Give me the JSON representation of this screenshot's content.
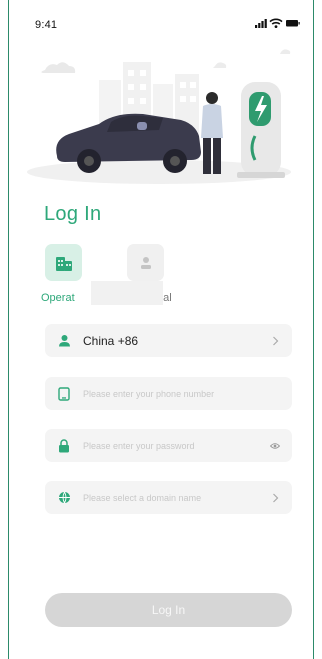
{
  "status_bar": {
    "time": "9:41"
  },
  "title": "Log In",
  "login_types": [
    {
      "label": "Operat",
      "icon": "building-icon",
      "selected": true
    },
    {
      "label": "nal",
      "icon": "person-icon",
      "selected": false
    }
  ],
  "form": {
    "country": {
      "value": "China +86",
      "icon": "user-icon"
    },
    "phone": {
      "placeholder": "Please enter your phone number",
      "icon": "phone-icon"
    },
    "password": {
      "placeholder": "Please enter your password",
      "icon": "lock-icon"
    },
    "domain": {
      "placeholder": "Please select a domain name",
      "icon": "globe-icon"
    }
  },
  "login_button": "Log In",
  "colors": {
    "accent": "#2ea87a",
    "field_bg": "#f4f4f4",
    "button_disabled": "#d6d6d6"
  }
}
